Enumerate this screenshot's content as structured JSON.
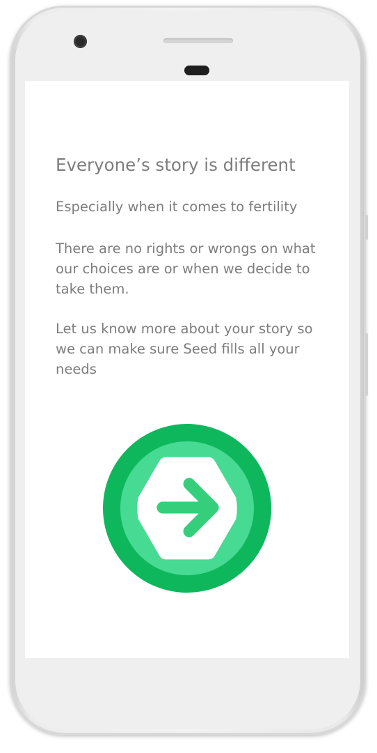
{
  "screen": {
    "title": "Everyone’s story is different",
    "paragraphs": [
      "Especially when it comes to fertility",
      "There are no rights or wrongs on what our choices are or when we decide to take them.",
      "Let us know more about your story so we can make sure Seed fills all your needs"
    ]
  },
  "next_button": {
    "icon": "arrow-right-icon",
    "colors": {
      "outer": "#0fb75c",
      "inner_ring": "#47da92",
      "center": "#ffffff",
      "arrow": "#35cf7b"
    }
  },
  "text_color": "#7d7d7d"
}
